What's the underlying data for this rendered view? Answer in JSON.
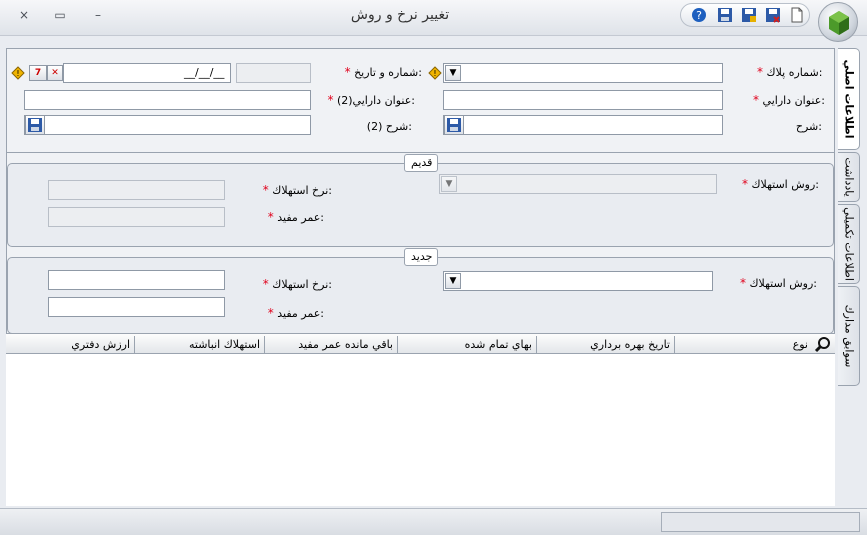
{
  "window": {
    "title": "تغيير نرخ و روش",
    "close_glyph": "×",
    "restore_glyph": "▭",
    "minimize_glyph": "–"
  },
  "toolbar_icons": [
    "help-icon",
    "save-icon",
    "save-as-icon",
    "save-close-icon",
    "new-document-icon"
  ],
  "main_form": {
    "plate_label": "شماره پلاك:",
    "plate_value": "",
    "number_date_label": "شماره و تاريخ:",
    "number_value": "",
    "date_value": "__/__/__",
    "asset_title_label": "عنوان دارايي:",
    "asset_title_value": "",
    "asset_title2_label": "عنوان دارايي(2):",
    "asset_title2_value": "",
    "description_label": "شرح:",
    "description_value": "",
    "description2_label": "شرح (2):",
    "description2_value": "",
    "required_mark": "*"
  },
  "old_group": {
    "title": "قديم",
    "method_label": "روش استهلاك:",
    "method_value": "",
    "rate_label": "نرخ استهلاك:",
    "rate_value": "",
    "life_label": "عمر مفيد:",
    "life_value": ""
  },
  "new_group": {
    "title": "جديد",
    "method_label": "روش استهلاك:",
    "method_value": "",
    "rate_label": "نرخ استهلاك:",
    "rate_value": "",
    "life_label": "عمر مفيد:",
    "life_value": ""
  },
  "grid": {
    "columns": [
      "نوع",
      "تاريخ بهره برداري",
      "بهاي تمام شده",
      "باقي مانده عمر مفيد",
      "استهلاك انباشته",
      "ارزش دفتري"
    ],
    "rows": []
  },
  "side_tabs": [
    "اطلاعات اصلي",
    "يادداشت",
    "اطلاعات تكميلي",
    "سوابق مدارك"
  ],
  "status_text": ""
}
